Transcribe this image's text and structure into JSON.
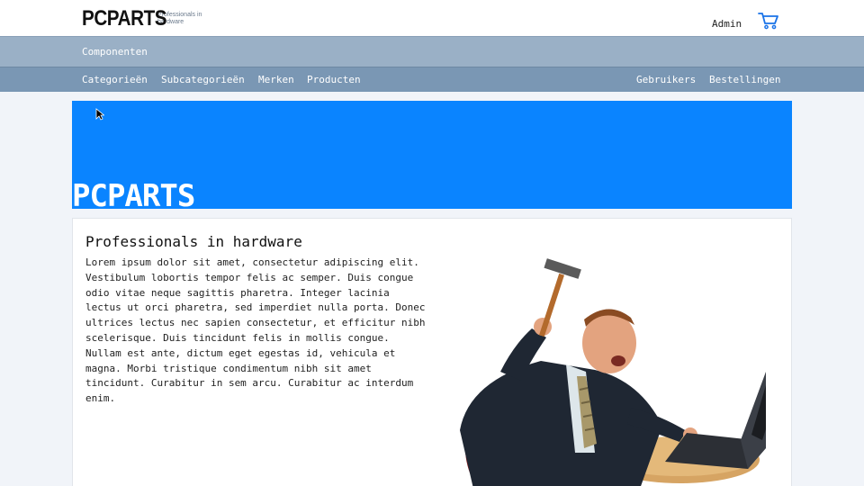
{
  "header": {
    "logo_text": "PCPARTS",
    "logo_tagline": "Professionals in hardware",
    "user_label": "Admin",
    "cart_icon": "cart-icon"
  },
  "nav_primary": {
    "items": [
      {
        "label": "Componenten"
      }
    ]
  },
  "nav_secondary": {
    "left": [
      {
        "label": "Categorieën"
      },
      {
        "label": "Subcategorieën"
      },
      {
        "label": "Merken"
      },
      {
        "label": "Producten"
      }
    ],
    "right": [
      {
        "label": "Gebruikers"
      },
      {
        "label": "Bestellingen"
      }
    ]
  },
  "hero": {
    "title": "PCPARTS",
    "background": "#0a84ff"
  },
  "content": {
    "heading": "Professionals in hardware",
    "body": "Lorem ipsum dolor sit amet, consectetur adipiscing elit. Vestibulum lobortis tempor felis ac semper. Duis congue odio vitae neque sagittis pharetra. Integer lacinia lectus ut orci pharetra, sed imperdiet nulla porta. Donec ultrices lectus nec sapien consectetur, et efficitur nibh scelerisque. Duis tincidunt felis in mollis congue. Nullam est ante, dictum eget egestas id, vehicula et magna. Morbi tristique condimentum nibh sit amet tincidunt. Curabitur in sem arcu. Curabitur ac interdum enim.",
    "image": "man-smashing-laptop-with-hammer"
  },
  "colors": {
    "nav_primary": "#9ab0c6",
    "nav_secondary": "#7a97b4",
    "accent": "#0a84ff"
  }
}
